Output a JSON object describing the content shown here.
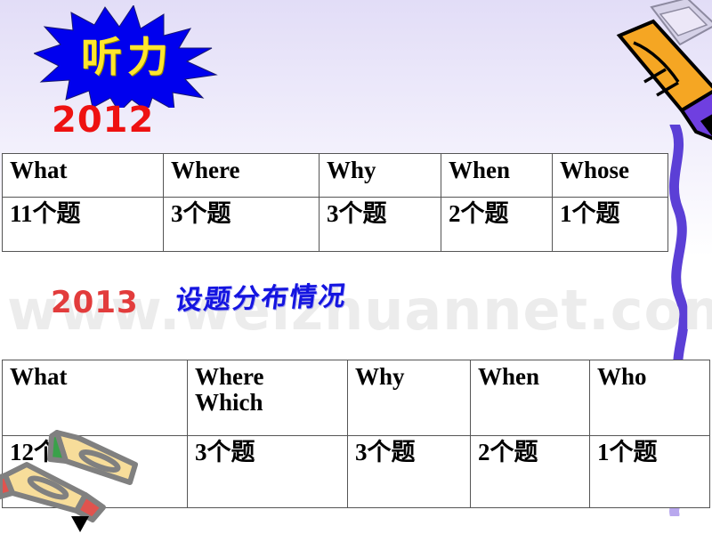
{
  "slide": {
    "title_badge": "听力",
    "subtitle_cn": "设题分布情况",
    "watermark": "www.weizhuannet.com",
    "year_2012": "2012",
    "year_2013": "2013",
    "colors": {
      "badge_fill": "#0000ee",
      "badge_text": "#ffe62e",
      "year_red": "#ee1111",
      "subtitle_blue": "#1414e0",
      "alt_word_red": "#ee0000",
      "watermark_gray": "#ececec",
      "pencil_body": "#f5a623",
      "pencil_tip": "#6f3fe0",
      "squiggle_dark": "#5b3fd6",
      "squiggle_light": "#b9a8ee",
      "crayon_body": "#f7dd9a",
      "crayon_outline": "#808080",
      "crayon_tip_green": "#3aa14a",
      "crayon_tip_red": "#e0534e"
    }
  },
  "table_2012": {
    "headers": [
      "What",
      "Where",
      "Why",
      "When",
      "Whose"
    ],
    "values": [
      "11个题",
      "3个题",
      "3个题",
      "2个题",
      "1个题"
    ]
  },
  "table_2013": {
    "headers": [
      "What",
      "Where",
      "Why",
      "When",
      "Who"
    ],
    "header_alt": [
      "",
      "Which",
      "",
      "",
      ""
    ],
    "values": [
      "12个题",
      "3个题",
      "3个题",
      "2个题",
      "1个题"
    ]
  },
  "icons": {
    "pencil": "pencil-icon",
    "squiggle": "squiggle-line-icon",
    "crayons": "crossed-crayons-icon",
    "starburst": "starburst-icon"
  }
}
